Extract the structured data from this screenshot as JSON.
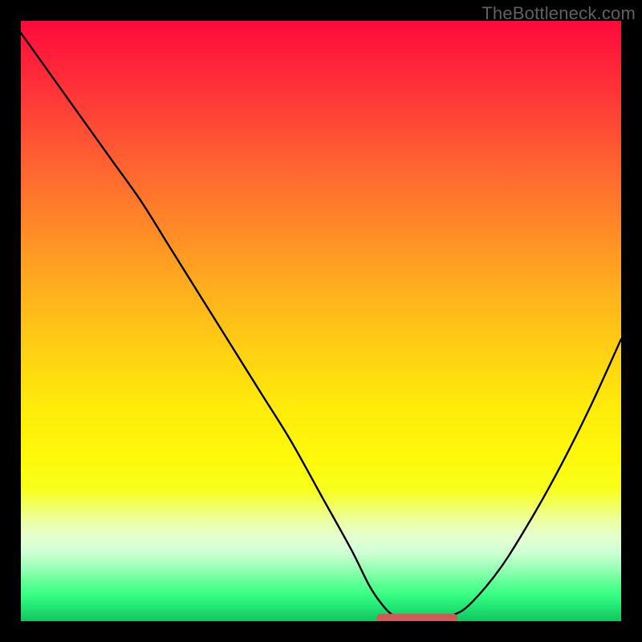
{
  "watermark": "TheBottleneck.com",
  "chart_data": {
    "type": "line",
    "title": "",
    "xlabel": "",
    "ylabel": "",
    "xlim": [
      0,
      100
    ],
    "ylim": [
      0,
      100
    ],
    "grid": false,
    "legend": false,
    "series": [
      {
        "name": "bottleneck-curve",
        "x": [
          0,
          5,
          10,
          15,
          20,
          25,
          30,
          35,
          40,
          45,
          50,
          55,
          58,
          60,
          62,
          65,
          68,
          72,
          75,
          80,
          85,
          90,
          95,
          100
        ],
        "y": [
          98,
          91,
          84,
          77,
          70,
          62,
          54,
          46,
          38,
          30,
          21,
          12,
          6,
          3,
          1,
          0,
          0,
          1,
          3,
          9,
          17,
          26,
          36,
          47
        ]
      }
    ],
    "annotation_segment": {
      "name": "optimal-range-marker",
      "color": "#cf5a57",
      "x_start": 60,
      "x_end": 72,
      "y": 0.5
    },
    "gradient_stops": [
      {
        "pos": 0,
        "color": "#ff0a3a"
      },
      {
        "pos": 0.5,
        "color": "#ffd312"
      },
      {
        "pos": 0.8,
        "color": "#f8ff1a"
      },
      {
        "pos": 1.0,
        "color": "#12c561"
      }
    ]
  }
}
